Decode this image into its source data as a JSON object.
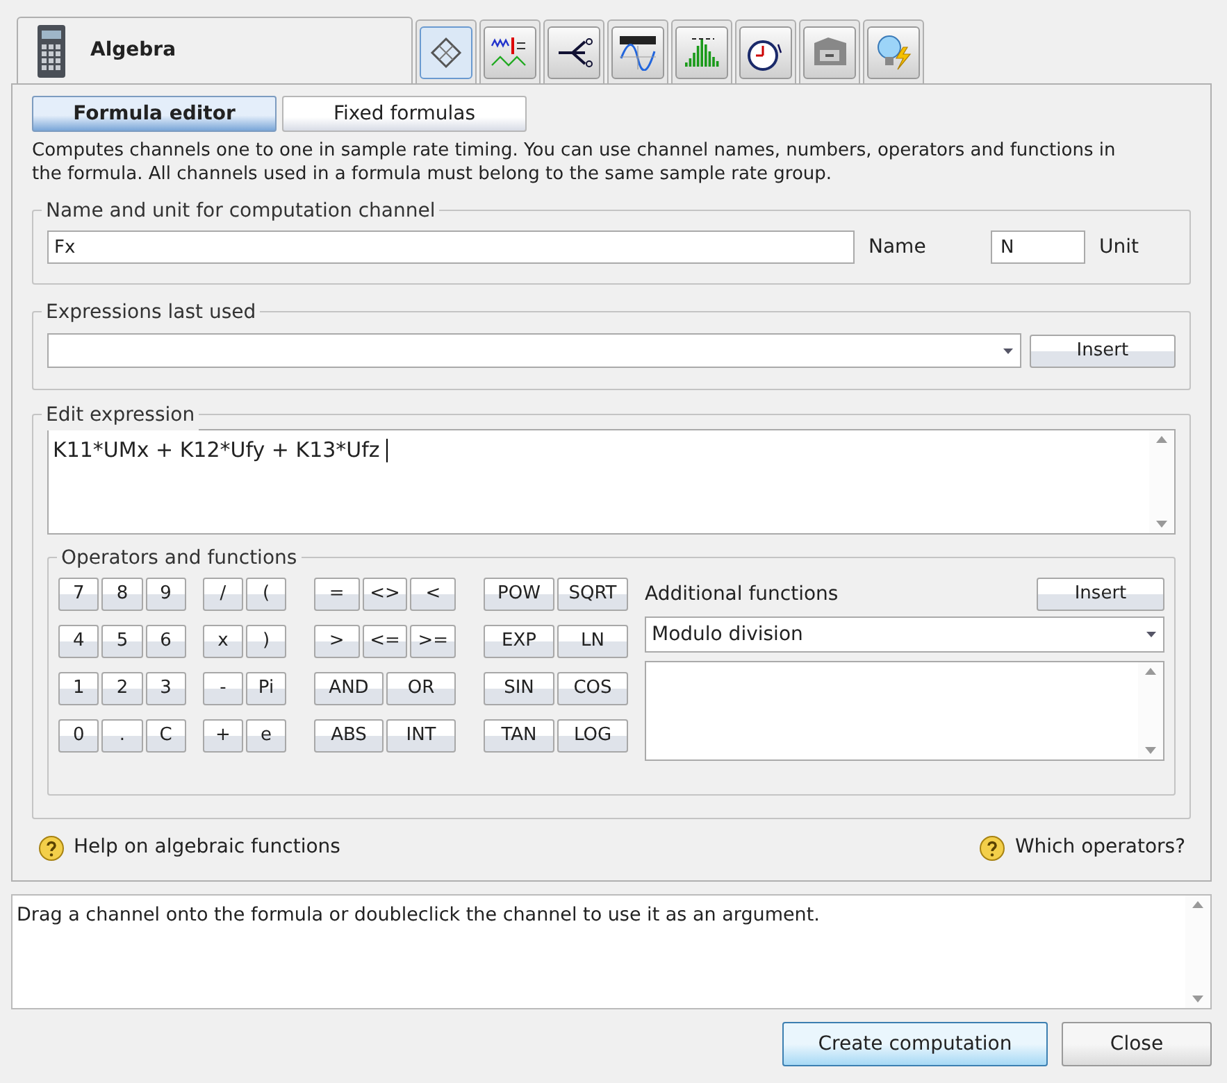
{
  "main_tab": {
    "label": "Algebra"
  },
  "tool_tabs": [
    {
      "kind": "bridge",
      "selected": true
    },
    {
      "kind": "filter",
      "selected": false
    },
    {
      "kind": "switch",
      "selected": false
    },
    {
      "kind": "scope",
      "selected": false
    },
    {
      "kind": "bars",
      "selected": false
    },
    {
      "kind": "angle",
      "selected": false
    },
    {
      "kind": "drawer",
      "selected": false
    },
    {
      "kind": "bulb",
      "selected": false
    }
  ],
  "sub_tabs": [
    {
      "label": "Formula editor",
      "selected": true
    },
    {
      "label": "Fixed formulas",
      "selected": false
    }
  ],
  "description": "Computes channels one to one in sample rate timing. You can use channel names, numbers, operators and functions in the formula. All channels used in a formula must belong to the same sample rate group.",
  "name_group": {
    "title": "Name and unit for computation channel",
    "name_value": "Fx",
    "name_label": "Name",
    "unit_value": "N",
    "unit_label": "Unit"
  },
  "last_used": {
    "title": "Expressions last used",
    "button": "Insert"
  },
  "edit": {
    "title": "Edit expression",
    "value": "K11*UMx + K12*Ufy + K13*Ufz"
  },
  "operators": {
    "title": "Operators and functions",
    "rows": [
      [
        [
          "7",
          "8",
          "9"
        ],
        [
          "/",
          "("
        ],
        [
          "=",
          "<>",
          "<"
        ],
        [
          "POW",
          "SQRT"
        ]
      ],
      [
        [
          "4",
          "5",
          "6"
        ],
        [
          "x",
          ")"
        ],
        [
          ">",
          "<=",
          ">="
        ],
        [
          "EXP",
          "LN"
        ]
      ],
      [
        [
          "1",
          "2",
          "3"
        ],
        [
          "-",
          "Pi"
        ],
        [
          "AND",
          "OR"
        ],
        [
          "SIN",
          "COS"
        ]
      ],
      [
        [
          "0",
          ".",
          "C"
        ],
        [
          "+",
          "e"
        ],
        [
          "ABS",
          "INT"
        ],
        [
          "TAN",
          "LOG"
        ]
      ]
    ],
    "additional_label": "Additional functions",
    "insert": "Insert",
    "selected_function": "Modulo division"
  },
  "help": [
    {
      "label": "Help on algebraic functions"
    },
    {
      "label": "Which operators?"
    }
  ],
  "message": "Drag a channel onto the formula or doubleclick the channel to use it as an argument.",
  "buttons": [
    {
      "label": "Create computation",
      "selected": true
    },
    {
      "label": "Close",
      "selected": false
    }
  ]
}
